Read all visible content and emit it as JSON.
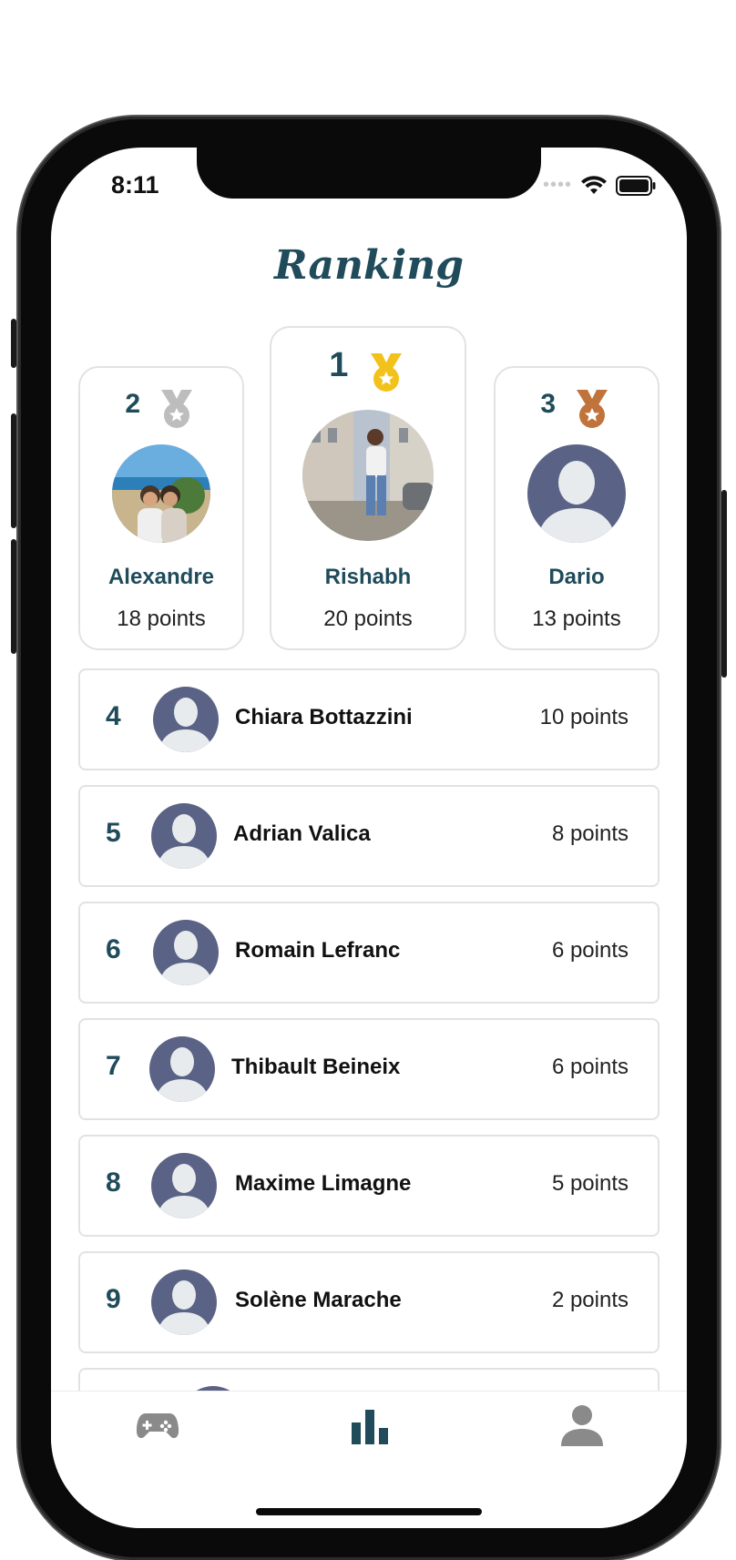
{
  "status": {
    "time": "8:11"
  },
  "header": {
    "title": "Ranking"
  },
  "podium": [
    {
      "rank": "2",
      "name": "Alexandre",
      "points": "18 points",
      "medal": "silver-medal-icon"
    },
    {
      "rank": "1",
      "name": "Rishabh",
      "points": "20 points",
      "medal": "gold-medal-icon"
    },
    {
      "rank": "3",
      "name": "Dario",
      "points": "13 points",
      "medal": "bronze-medal-icon"
    }
  ],
  "list": [
    {
      "rank": "4",
      "name": "Chiara Bottazzini",
      "points": "10 points"
    },
    {
      "rank": "5",
      "name": "Adrian Valica",
      "points": "8 points"
    },
    {
      "rank": "6",
      "name": "Romain Lefranc",
      "points": "6 points"
    },
    {
      "rank": "7",
      "name": "Thibault Beineix",
      "points": "6 points"
    },
    {
      "rank": "8",
      "name": "Maxime Limagne",
      "points": "5 points"
    },
    {
      "rank": "9",
      "name": "Solène Marache",
      "points": "2 points"
    }
  ],
  "tabs": [
    {
      "icon": "gamepad-icon"
    },
    {
      "icon": "bar-chart-icon",
      "active": true
    },
    {
      "icon": "user-icon"
    }
  ],
  "colors": {
    "accent": "#1f4b5a",
    "avatar": "#5a6385",
    "gold": "#f2c21b",
    "silver": "#bdbdbd",
    "bronze": "#c0733a"
  }
}
